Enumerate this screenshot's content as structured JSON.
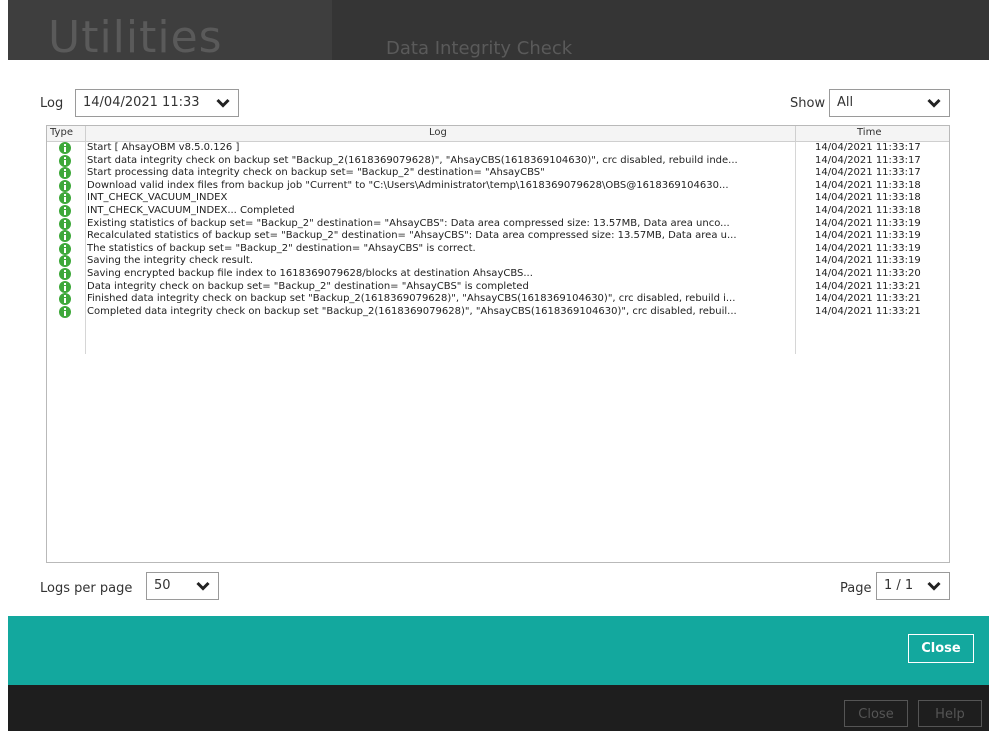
{
  "background": {
    "title": "Utilities",
    "subtitle": "Data Integrity Check",
    "footer_close": "Close",
    "footer_help": "Help"
  },
  "log_filter": {
    "label": "Log",
    "selected": "14/04/2021 11:33",
    "show_label": "Show",
    "show_selected": "All"
  },
  "table": {
    "columns": [
      "Type",
      "Log",
      "Time"
    ],
    "rows": [
      {
        "type": "info",
        "log": "Start [ AhsayOBM v8.5.0.126 ]",
        "time": "14/04/2021 11:33:17"
      },
      {
        "type": "info",
        "log": "Start data integrity check on backup set \"Backup_2(1618369079628)\", \"AhsayCBS(1618369104630)\", crc disabled, rebuild inde...",
        "time": "14/04/2021 11:33:17"
      },
      {
        "type": "info",
        "log": "Start processing data integrity check on backup set= \"Backup_2\" destination= \"AhsayCBS\"",
        "time": "14/04/2021 11:33:17"
      },
      {
        "type": "info",
        "log": "Download valid index files from backup job \"Current\" to \"C:\\Users\\Administrator\\temp\\1618369079628\\OBS@1618369104630...",
        "time": "14/04/2021 11:33:18"
      },
      {
        "type": "info",
        "log": "INT_CHECK_VACUUM_INDEX",
        "time": "14/04/2021 11:33:18"
      },
      {
        "type": "info",
        "log": "INT_CHECK_VACUUM_INDEX... Completed",
        "time": "14/04/2021 11:33:18"
      },
      {
        "type": "info",
        "log": "Existing statistics of backup set= \"Backup_2\" destination= \"AhsayCBS\": Data area compressed size: 13.57MB, Data area unco...",
        "time": "14/04/2021 11:33:19"
      },
      {
        "type": "info",
        "log": "Recalculated statistics of backup set= \"Backup_2\" destination= \"AhsayCBS\": Data area compressed size: 13.57MB, Data area u...",
        "time": "14/04/2021 11:33:19"
      },
      {
        "type": "info",
        "log": "The statistics of backup set= \"Backup_2\" destination= \"AhsayCBS\" is correct.",
        "time": "14/04/2021 11:33:19"
      },
      {
        "type": "info",
        "log": "Saving the integrity check result.",
        "time": "14/04/2021 11:33:19"
      },
      {
        "type": "info",
        "log": "Saving encrypted backup file index to 1618369079628/blocks at destination AhsayCBS...",
        "time": "14/04/2021 11:33:20"
      },
      {
        "type": "info",
        "log": "Data integrity check on backup set= \"Backup_2\" destination= \"AhsayCBS\" is completed",
        "time": "14/04/2021 11:33:21"
      },
      {
        "type": "info",
        "log": "Finished data integrity check on backup set \"Backup_2(1618369079628)\", \"AhsayCBS(1618369104630)\", crc disabled, rebuild i...",
        "time": "14/04/2021 11:33:21"
      },
      {
        "type": "info",
        "log": "Completed data integrity check on backup set \"Backup_2(1618369079628)\", \"AhsayCBS(1618369104630)\", crc disabled, rebuil...",
        "time": "14/04/2021 11:33:21"
      }
    ]
  },
  "pagination": {
    "per_page_label": "Logs per page",
    "per_page_value": "50",
    "page_label": "Page",
    "page_value": "1 / 1"
  },
  "actions": {
    "close_label": "Close"
  },
  "colors": {
    "accent": "#13a89e",
    "info_icon": "#3ea83a"
  }
}
